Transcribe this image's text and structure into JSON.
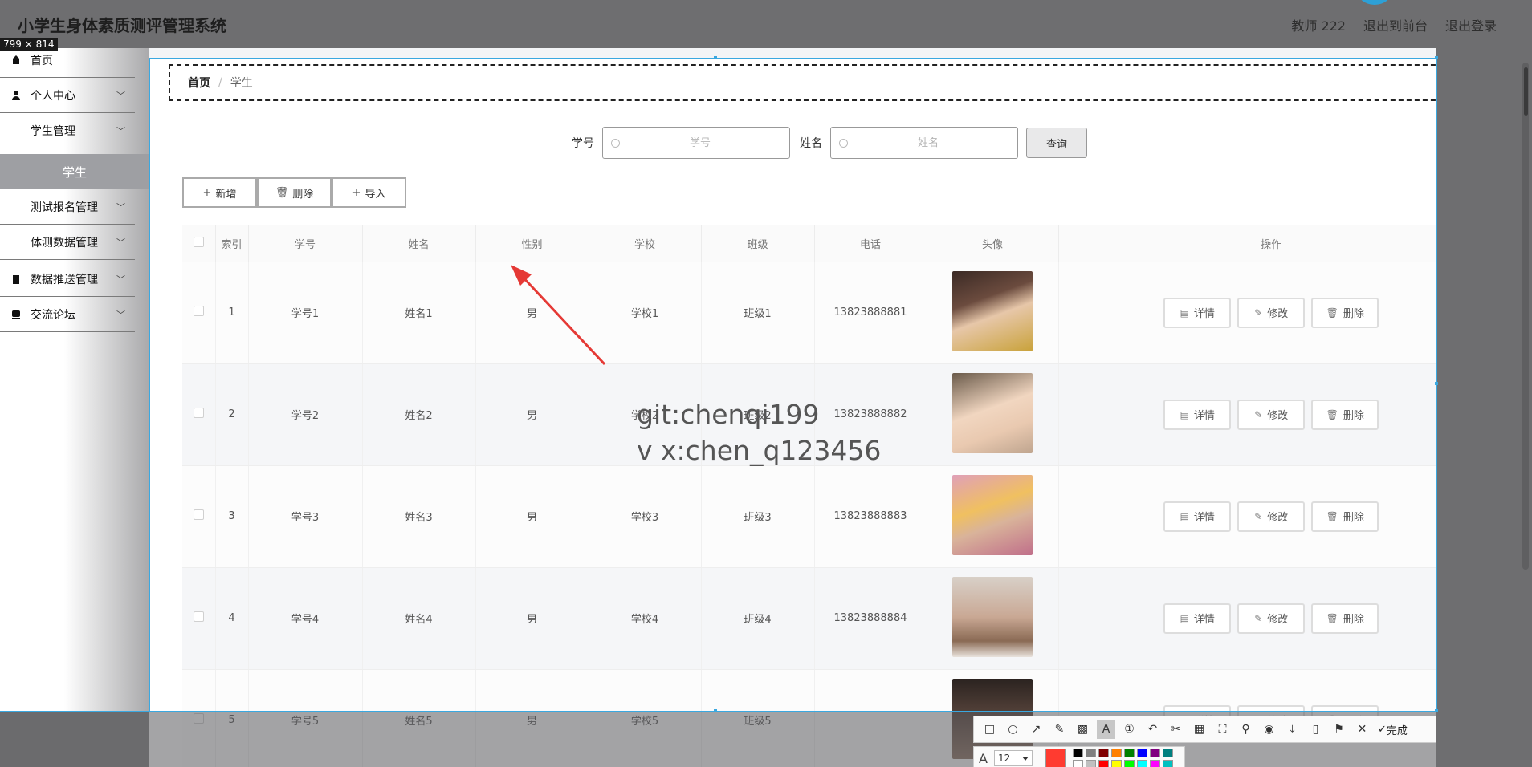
{
  "header": {
    "title": "小学生身体素质测评管理系统",
    "links": [
      "教师 222",
      "退出到前台",
      "退出登录"
    ]
  },
  "capture": {
    "size_label": "799 × 814"
  },
  "sidebar": {
    "items": [
      {
        "label": "首页",
        "icon": "home-icon",
        "has_chevron": false
      },
      {
        "label": "个人中心",
        "icon": "user-icon",
        "has_chevron": true
      },
      {
        "label": "学生管理",
        "icon": "grid-icon",
        "has_chevron": true
      },
      {
        "label": "测试报名管理",
        "icon": "grid-icon",
        "has_chevron": true
      },
      {
        "label": "体测数据管理",
        "icon": "grid-icon",
        "has_chevron": true
      },
      {
        "label": "数据推送管理",
        "icon": "clipboard-icon",
        "has_chevron": true
      },
      {
        "label": "交流论坛",
        "icon": "forum-icon",
        "has_chevron": true
      }
    ],
    "active_sub": "学生"
  },
  "breadcrumb": {
    "home": "首页",
    "separator": "/",
    "current": "学生"
  },
  "search": {
    "fields": [
      {
        "label": "学号",
        "placeholder": "学号",
        "value": ""
      },
      {
        "label": "姓名",
        "placeholder": "姓名",
        "value": ""
      }
    ],
    "query_label": "查询"
  },
  "actions": [
    {
      "symbol": "+",
      "label": "新增"
    },
    {
      "symbol": "🗑",
      "label": "删除"
    },
    {
      "symbol": "+",
      "label": "导入"
    }
  ],
  "table": {
    "headers": [
      "",
      "索引",
      "学号",
      "姓名",
      "性别",
      "学校",
      "班级",
      "电话",
      "头像",
      "操作"
    ],
    "rows": [
      {
        "index": "1",
        "sid": "学号1",
        "name": "姓名1",
        "gender": "男",
        "school": "学校1",
        "cls": "班级1",
        "phone": "13823888881"
      },
      {
        "index": "2",
        "sid": "学号2",
        "name": "姓名2",
        "gender": "男",
        "school": "学校2",
        "cls": "班级2",
        "phone": "13823888882"
      },
      {
        "index": "3",
        "sid": "学号3",
        "name": "姓名3",
        "gender": "男",
        "school": "学校3",
        "cls": "班级3",
        "phone": "13823888883"
      },
      {
        "index": "4",
        "sid": "学号4",
        "name": "姓名4",
        "gender": "男",
        "school": "学校4",
        "cls": "班级4",
        "phone": "13823888884"
      },
      {
        "index": "5",
        "sid": "学号5",
        "name": "姓名5",
        "gender": "男",
        "school": "学校5",
        "cls": "班级5",
        "phone": ""
      }
    ],
    "row_actions": [
      {
        "symbol": "▤",
        "label": "详情"
      },
      {
        "symbol": "✎",
        "label": "修改"
      },
      {
        "symbol": "🗑",
        "label": "删除"
      }
    ]
  },
  "watermark": {
    "line1": "git:chenqi199",
    "line2": "v x:chen_q123456"
  },
  "screenshot_toolbar": {
    "done_label": "完成",
    "font_size": "12",
    "current_color": "#ff3b30",
    "palette": [
      "#000000",
      "#808080",
      "#800000",
      "#ff8000",
      "#008000",
      "#0000ff",
      "#800080",
      "#008080",
      "#ffffff",
      "#c0c0c0",
      "#ff0000",
      "#ffff00",
      "#00ff00",
      "#00ffff",
      "#ff00ff",
      "#00c0c0"
    ]
  },
  "colors": {
    "accent": "#3aa8e0",
    "annotation_arrow": "#e53935"
  }
}
